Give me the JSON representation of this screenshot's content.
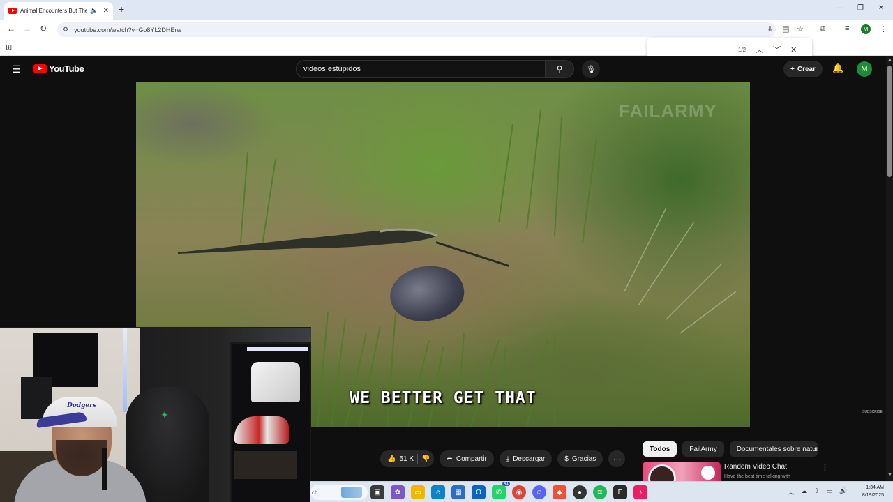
{
  "browser": {
    "tab_title": "Animal Encounters But The",
    "audio_icon": "speaker-icon",
    "url": "youtube.com/watch?v=Go8YL2DHErw",
    "find_count": "1/2"
  },
  "youtube": {
    "logo_text": "YouTube",
    "search_value": "videos estupidos",
    "create_label": "Crear",
    "avatar_letter": "M"
  },
  "video": {
    "watermark": "FAILARMY",
    "caption": "WE BETTER GET THAT",
    "corner_label": "SUBSCRIBE"
  },
  "actions": {
    "like_count": "51 K",
    "share_label": "Compartir",
    "download_label": "Descargar",
    "thanks_label": "Gracias"
  },
  "chips": [
    "Todos",
    "FailArmy",
    "Documentales sobre natural"
  ],
  "recommendation": {
    "title": "Random Video Chat",
    "subtitle": "Have the best time talking with"
  },
  "webcam": {
    "cap_text": "Dodgers"
  },
  "taskbar": {
    "search_text": "ch",
    "whatsapp_badge": "41",
    "time": "1:34 AM",
    "date": "8/19/2025"
  },
  "colors": {
    "yt_red": "#ff0000",
    "yt_bg": "#0f0f0f",
    "chip_active": "#f1f1f1"
  }
}
